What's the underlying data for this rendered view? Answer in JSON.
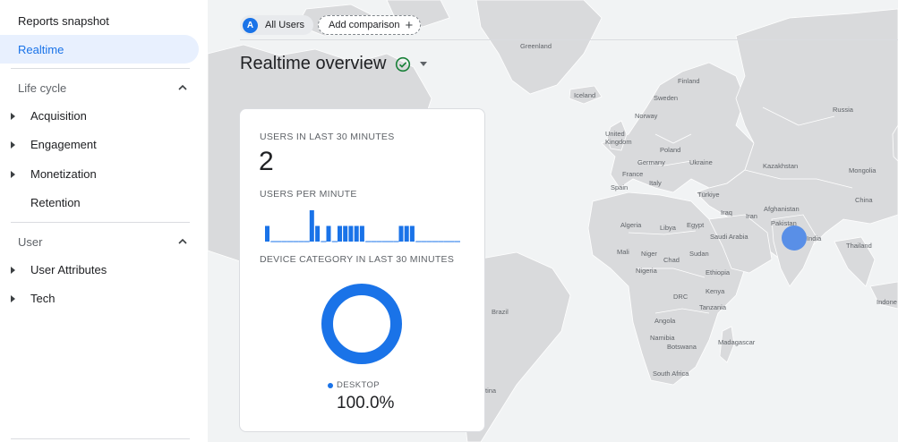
{
  "sidebar": {
    "reports_snapshot": "Reports snapshot",
    "realtime": "Realtime",
    "lifecycle": {
      "title": "Life cycle",
      "items": [
        "Acquisition",
        "Engagement",
        "Monetization",
        "Retention"
      ]
    },
    "user": {
      "title": "User",
      "items": [
        "User Attributes",
        "Tech"
      ]
    }
  },
  "comparison": {
    "all_users_badge": "A",
    "all_users": "All Users",
    "add_comparison": "Add comparison"
  },
  "header": {
    "title": "Realtime overview"
  },
  "card": {
    "users_label": "USERS IN LAST 30 MINUTES",
    "users_count": "2",
    "per_minute_label": "USERS PER MINUTE",
    "per_minute_values": [
      1,
      0,
      0,
      0,
      0,
      0,
      0,
      0,
      2,
      1,
      0,
      1,
      0,
      1,
      1,
      1,
      1,
      1,
      0,
      0,
      0,
      0,
      0,
      0,
      1,
      1,
      1,
      0,
      0,
      0,
      0,
      0,
      0,
      0,
      0
    ],
    "device_label": "DEVICE CATEGORY IN LAST 30 MINUTES",
    "device_legend": "DESKTOP",
    "device_percent": "100.0%"
  },
  "map": {
    "labels": [
      "Greenland",
      "Finland",
      "Iceland",
      "Sweden",
      "Norway",
      "Russia",
      "United Kingdom",
      "Poland",
      "Germany",
      "Ukraine",
      "France",
      "Kazakhstan",
      "Mongolia",
      "Spain",
      "Italy",
      "Türkiye",
      "China",
      "Afghanistan",
      "Iraq",
      "Iran",
      "Pakistan",
      "India",
      "Algeria",
      "Libya",
      "Egypt",
      "Saudi Arabia",
      "Thailand",
      "Mali",
      "Niger",
      "Chad",
      "Sudan",
      "Nigeria",
      "Ethiopia",
      "DRC",
      "Kenya",
      "Tanzania",
      "Angola",
      "Namibia",
      "Botswana",
      "Madagascar",
      "South Africa",
      "Brazil",
      "Indone",
      "tina"
    ],
    "colors": {
      "land": "#d9dadc",
      "water": "#f1f3f4",
      "border": "#ffffff",
      "marker": "#4a86e8"
    }
  },
  "colors": {
    "accent": "#1a73e8",
    "active_bg": "#e8f0fe",
    "check": "#188038"
  }
}
